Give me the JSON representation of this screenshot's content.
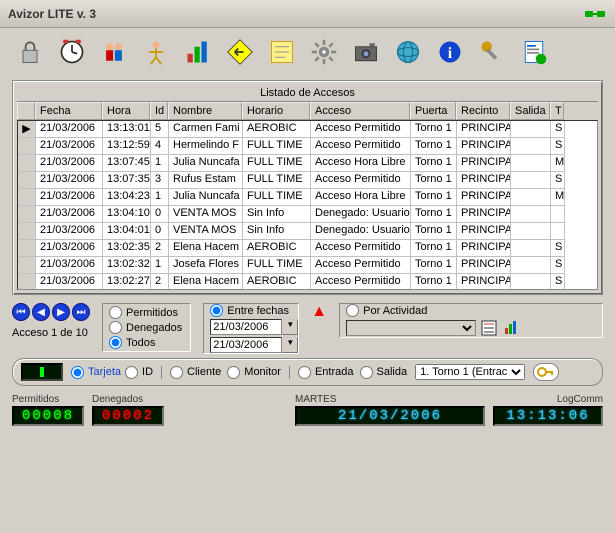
{
  "title": "Avizor LITE v. 3",
  "grid_title": "Listado de Accesos",
  "columns": [
    "",
    "Fecha",
    "Hora",
    "Id",
    "Nombre",
    "Horario",
    "Acceso",
    "Puerta",
    "Recinto",
    "Salida",
    "T"
  ],
  "rows": [
    {
      "marker": "▶",
      "fecha": "21/03/2006",
      "hora": "13:13:01",
      "id": "5",
      "nombre": "Carmen Fami",
      "horario": "AEROBIC",
      "acceso": "Acceso Permitido",
      "puerta": "Torno 1",
      "recinto": "PRINCIPA",
      "salida": "",
      "t": "S"
    },
    {
      "marker": "",
      "fecha": "21/03/2006",
      "hora": "13:12:59",
      "id": "4",
      "nombre": "Hermelindo F",
      "horario": "FULL TIME",
      "acceso": "Acceso Permitido",
      "puerta": "Torno 1",
      "recinto": "PRINCIPA",
      "salida": "",
      "t": "S"
    },
    {
      "marker": "",
      "fecha": "21/03/2006",
      "hora": "13:07:45",
      "id": "1",
      "nombre": "Julia Nuncafa",
      "horario": "FULL TIME",
      "acceso": "Acceso Hora Libre",
      "puerta": "Torno 1",
      "recinto": "PRINCIPA",
      "salida": "",
      "t": "M"
    },
    {
      "marker": "",
      "fecha": "21/03/2006",
      "hora": "13:07:35",
      "id": "3",
      "nombre": "Rufus Estam",
      "horario": "FULL TIME",
      "acceso": "Acceso Permitido",
      "puerta": "Torno 1",
      "recinto": "PRINCIPA",
      "salida": "",
      "t": "S"
    },
    {
      "marker": "",
      "fecha": "21/03/2006",
      "hora": "13:04:23",
      "id": "1",
      "nombre": "Julia Nuncafa",
      "horario": "FULL TIME",
      "acceso": "Acceso Hora Libre",
      "puerta": "Torno 1",
      "recinto": "PRINCIPA",
      "salida": "",
      "t": "M"
    },
    {
      "marker": "",
      "fecha": "21/03/2006",
      "hora": "13:04:10",
      "id": "0",
      "nombre": "VENTA MOS",
      "horario": "Sin Info",
      "acceso": "Denegado: Usuario",
      "puerta": "Torno 1",
      "recinto": "PRINCIPA",
      "salida": "",
      "t": ""
    },
    {
      "marker": "",
      "fecha": "21/03/2006",
      "hora": "13:04:01",
      "id": "0",
      "nombre": "VENTA MOS",
      "horario": "Sin Info",
      "acceso": "Denegado: Usuario",
      "puerta": "Torno 1",
      "recinto": "PRINCIPA",
      "salida": "",
      "t": ""
    },
    {
      "marker": "",
      "fecha": "21/03/2006",
      "hora": "13:02:35",
      "id": "2",
      "nombre": "Elena Hacem",
      "horario": "AEROBIC",
      "acceso": "Acceso Permitido",
      "puerta": "Torno 1",
      "recinto": "PRINCIPA",
      "salida": "",
      "t": "S"
    },
    {
      "marker": "",
      "fecha": "21/03/2006",
      "hora": "13:02:32",
      "id": "1",
      "nombre": "Josefa Flores",
      "horario": "FULL TIME",
      "acceso": "Acceso Permitido",
      "puerta": "Torno 1",
      "recinto": "PRINCIPA",
      "salida": "",
      "t": "S"
    },
    {
      "marker": "",
      "fecha": "21/03/2006",
      "hora": "13:02:27",
      "id": "2",
      "nombre": "Elena Hacem",
      "horario": "AEROBIC",
      "acceso": "Acceso Permitido",
      "puerta": "Torno 1",
      "recinto": "PRINCIPA",
      "salida": "",
      "t": "S"
    }
  ],
  "nav_label": "Acceso 1 de 10",
  "filter": {
    "permitidos": "Permitidos",
    "denegados": "Denegados",
    "todos": "Todos",
    "todos_checked": true,
    "entre_fechas": "Entre fechas",
    "entre_fechas_checked": true,
    "date_from": "21/03/2006",
    "date_to": "21/03/2006",
    "por_actividad": "Por Actividad",
    "por_actividad_checked": false
  },
  "bottom": {
    "tarjeta": "Tarjeta",
    "id": "ID",
    "cliente": "Cliente",
    "monitor": "Monitor",
    "entrada": "Entrada",
    "salida": "Salida",
    "door_select": "1. Torno 1 (Entrac"
  },
  "status": {
    "permitidos_label": "Permitidos",
    "permitidos_value": "00008",
    "denegados_label": "Denegados",
    "denegados_value": "00002",
    "day_label": "MARTES",
    "date_value": "21/03/2006",
    "logcomm_label": "LogComm",
    "time_value": "13:13:06"
  }
}
